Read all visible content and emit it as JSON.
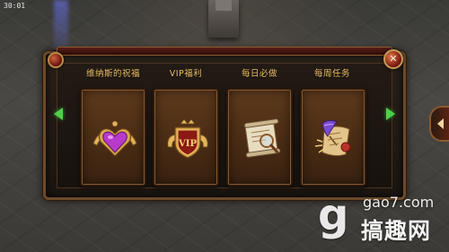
{
  "status": {
    "clock": "30:01"
  },
  "dialog": {
    "close_glyph": "✕",
    "tabs": [
      {
        "label": "维纳斯的祝福",
        "icon": "heart-crest-icon"
      },
      {
        "label": "VIP福利",
        "icon": "vip-shield-icon",
        "badge": "VIP"
      },
      {
        "label": "每日必做",
        "icon": "scroll-map-icon"
      },
      {
        "label": "每周任务",
        "icon": "quest-scroll-icon"
      }
    ]
  },
  "watermark": {
    "logo_glyph": "g",
    "site": "gao7.com",
    "name": "搞趣网"
  },
  "colors": {
    "accent_gold": "#f0c36a",
    "card_bg": "#4a2c14",
    "arrow_green": "#4fd04a"
  }
}
